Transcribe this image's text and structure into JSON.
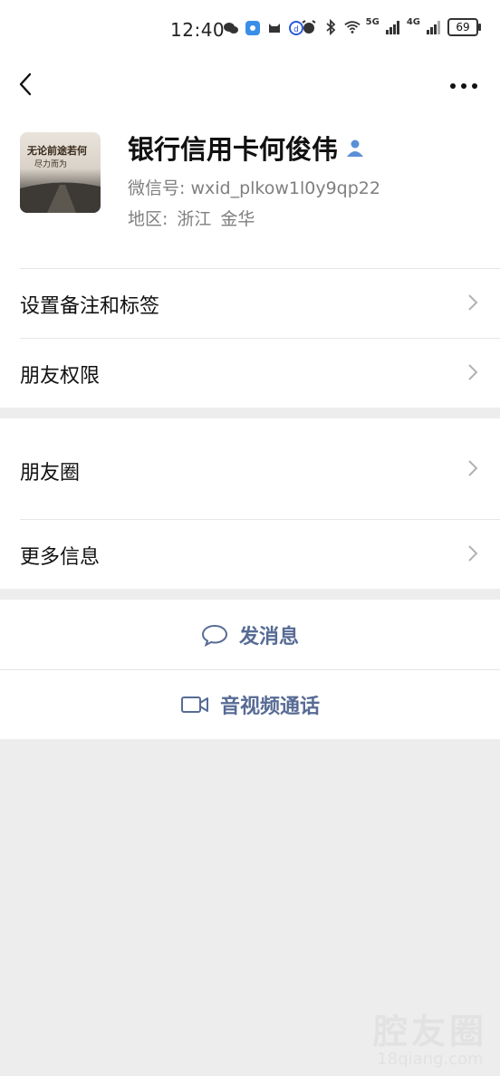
{
  "status_bar": {
    "time": "12:40",
    "battery": "69",
    "net1": "5G",
    "net2": "4G"
  },
  "profile": {
    "name": "银行信用卡何俊伟",
    "wechat_id": "微信号:  wxid_plkow1l0y9qp22",
    "region_label": "地区:",
    "province": "浙江",
    "city": "金华"
  },
  "menu": {
    "remarks": "设置备注和标签",
    "permissions": "朋友权限",
    "moments": "朋友圈",
    "more_info": "更多信息"
  },
  "actions": {
    "message": "发消息",
    "call": "音视频通话"
  },
  "watermark": {
    "main": "腔友圈",
    "sub": "18qiang.com"
  },
  "colors": {
    "accent": "#576b95",
    "background": "#ededed"
  }
}
